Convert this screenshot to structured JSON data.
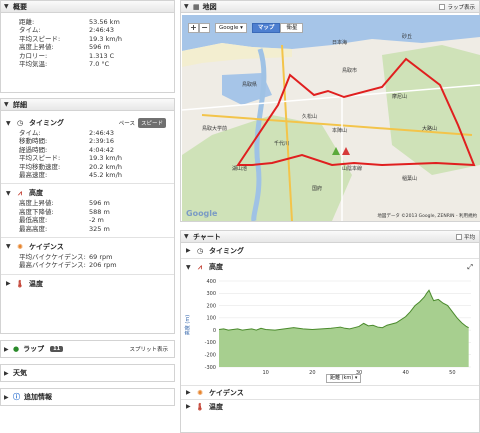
{
  "overview": {
    "title": "概要",
    "rows": [
      {
        "k": "距離:",
        "v": "53.56 km"
      },
      {
        "k": "タイム:",
        "v": "2:46:43"
      },
      {
        "k": "平均スピード:",
        "v": "19.3 km/h"
      },
      {
        "k": "高度上昇値:",
        "v": "596 m"
      },
      {
        "k": "カロリー:",
        "v": "1.313 C"
      },
      {
        "k": "平均気温:",
        "v": "7.0 °C"
      }
    ]
  },
  "details": {
    "title": "詳細",
    "timing": {
      "title": "タイミング",
      "pace": "ペース",
      "speed": "スピード",
      "rows": [
        {
          "k": "タイム:",
          "v": "2:46:43"
        },
        {
          "k": "移動時間:",
          "v": "2:39:16"
        },
        {
          "k": "経過時間:",
          "v": "4:04:42"
        },
        {
          "k": "平均スピード:",
          "v": "19.3 km/h"
        },
        {
          "k": "平均移動速度:",
          "v": "20.2 km/h"
        },
        {
          "k": "最高速度:",
          "v": "45.2 km/h"
        }
      ]
    },
    "elevation": {
      "title": "高度",
      "rows": [
        {
          "k": "高度上昇値:",
          "v": "596 m"
        },
        {
          "k": "高度下降値:",
          "v": "588 m"
        },
        {
          "k": "最低高度:",
          "v": "-2 m"
        },
        {
          "k": "最高高度:",
          "v": "325 m"
        }
      ]
    },
    "cadence": {
      "title": "ケイデンス",
      "rows": [
        {
          "k": "平均バイクケイデンス:",
          "v": "69 rpm"
        },
        {
          "k": "最高バイクケイデンス:",
          "v": "206 rpm"
        }
      ]
    },
    "temperature": {
      "title": "温度"
    }
  },
  "laps": {
    "title": "ラップ",
    "count": "11",
    "split": "スプリット表示"
  },
  "weather": {
    "title": "天気"
  },
  "moreinfo": {
    "title": "追加情報"
  },
  "map": {
    "title": "地図",
    "lap_toggle": "ラップ表示",
    "zoom_in": "+",
    "zoom_out": "−",
    "provider": "Google",
    "type_map": "マップ",
    "type_sat": "衛星",
    "copyright": "地図データ ©2013 Google, ZENRIN - 利用規約",
    "places": [
      "鳥取市",
      "鳥取県",
      "久松山",
      "本陣山",
      "摩尼山",
      "鳥取大学前",
      "砂丘",
      "日本海",
      "湖山池",
      "稲葉山",
      "山陰本線",
      "国府",
      "千代川",
      "大路山"
    ]
  },
  "chart": {
    "title": "チャート",
    "pace_toggle": "平均",
    "timing_label": "タイミング",
    "elevation_label": "高度",
    "cadence_label": "ケイデンス",
    "temperature_label": "温度",
    "axis_select": "距離 (km)"
  },
  "chart_data": {
    "type": "area",
    "title": "",
    "xlabel": "距離 (km)",
    "ylabel": "高度 (m)",
    "xlim": [
      0,
      54
    ],
    "ylim": [
      -300,
      400
    ],
    "x_ticks": [
      10,
      20,
      30,
      40,
      50
    ],
    "y_ticks": [
      400,
      300,
      200,
      100,
      0,
      -100,
      -200,
      -300
    ],
    "color": "#4a8a2c",
    "fill": "#a7cf8f",
    "series": [
      {
        "x": [
          0,
          1,
          2,
          3,
          4,
          5,
          6,
          7,
          8,
          9,
          10,
          12,
          14,
          16,
          18,
          20,
          22,
          24,
          25,
          26,
          27,
          28,
          29,
          30,
          31,
          32,
          33,
          34,
          35,
          36,
          38,
          40,
          41,
          42,
          43,
          44,
          44.5,
          45,
          45.5,
          46,
          47,
          48,
          49,
          50,
          51,
          52,
          53,
          53.5
        ],
        "y": [
          5,
          10,
          0,
          5,
          10,
          0,
          5,
          10,
          0,
          15,
          5,
          0,
          10,
          20,
          10,
          5,
          10,
          15,
          20,
          25,
          15,
          10,
          20,
          30,
          55,
          35,
          40,
          25,
          20,
          40,
          60,
          110,
          150,
          200,
          230,
          270,
          300,
          325,
          280,
          240,
          250,
          220,
          200,
          150,
          100,
          60,
          30,
          20
        ]
      }
    ]
  }
}
